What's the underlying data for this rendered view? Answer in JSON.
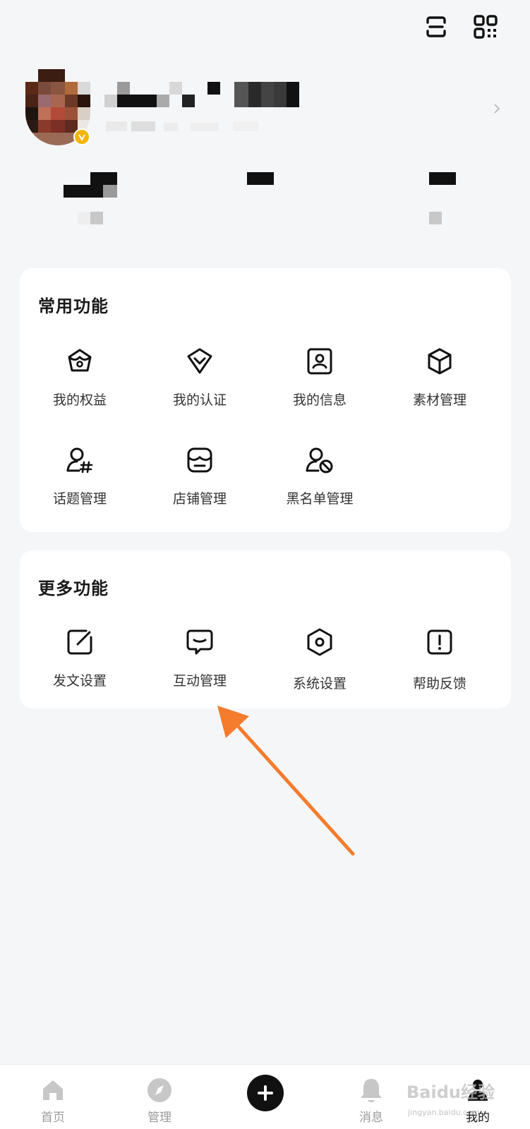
{
  "header": {
    "icons": [
      "scan-icon",
      "qr-code-icon"
    ]
  },
  "profile": {
    "chevron_icon": "chevron-right-icon"
  },
  "common_features": {
    "title": "常用功能",
    "items": [
      {
        "label": "我的权益",
        "icon": "crown-basket-icon"
      },
      {
        "label": "我的认证",
        "icon": "verify-shield-icon"
      },
      {
        "label": "我的信息",
        "icon": "profile-card-icon"
      },
      {
        "label": "素材管理",
        "icon": "cube-icon"
      },
      {
        "label": "话题管理",
        "icon": "user-hashtag-icon"
      },
      {
        "label": "店铺管理",
        "icon": "store-icon"
      },
      {
        "label": "黑名单管理",
        "icon": "user-block-icon"
      }
    ]
  },
  "more_features": {
    "title": "更多功能",
    "items": [
      {
        "label": "发文设置",
        "icon": "edit-square-icon"
      },
      {
        "label": "互动管理",
        "icon": "message-bubble-icon"
      },
      {
        "label": "系统设置",
        "icon": "settings-hexagon-icon"
      },
      {
        "label": "帮助反馈",
        "icon": "exclamation-square-icon"
      }
    ]
  },
  "annotation": {
    "arrow_color": "#f47c2c"
  },
  "bottom_nav": {
    "items": [
      {
        "label": "首页",
        "icon": "home-icon",
        "active": false
      },
      {
        "label": "管理",
        "icon": "compass-icon",
        "active": false
      },
      {
        "label": "",
        "icon": "plus-icon",
        "active": false
      },
      {
        "label": "消息",
        "icon": "bell-icon",
        "active": false
      },
      {
        "label": "我的",
        "icon": "person-icon",
        "active": true
      }
    ]
  },
  "watermark": {
    "main": "Baidu经验",
    "sub": "jingyan.baidu.com"
  },
  "colors": {
    "background": "#f5f6f8",
    "card": "#ffffff",
    "accent_arrow": "#f47c2c",
    "verify_badge": "#f5b400"
  }
}
